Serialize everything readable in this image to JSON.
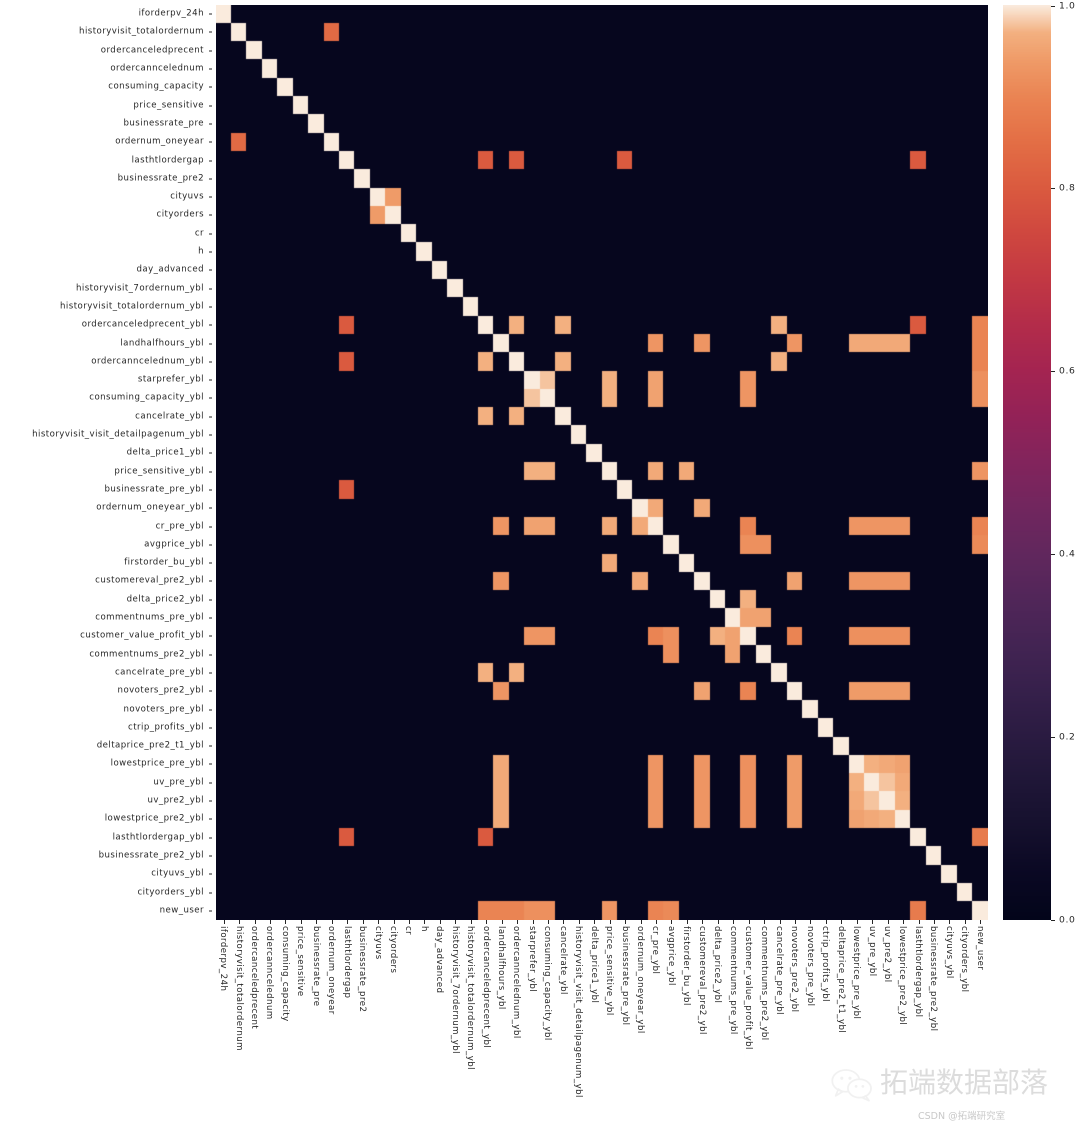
{
  "figure": {
    "type": "correlation-heatmap",
    "background": "#ffffff"
  },
  "colorbar": {
    "name": "rocket",
    "vmin": 0.0,
    "vmax": 1.0,
    "ticks": [
      "0.0",
      "0.2",
      "0.4",
      "0.6",
      "0.8",
      "1.0"
    ],
    "tick_values": [
      0.0,
      0.2,
      0.4,
      0.6,
      0.8,
      1.0
    ],
    "stops": [
      {
        "t": 0.0,
        "hex": "#03051A"
      },
      {
        "t": 0.05,
        "hex": "#0A0823"
      },
      {
        "t": 0.1,
        "hex": "#15102D"
      },
      {
        "t": 0.15,
        "hex": "#1F1637"
      },
      {
        "t": 0.2,
        "hex": "#2A1B41"
      },
      {
        "t": 0.25,
        "hex": "#36204B"
      },
      {
        "t": 0.3,
        "hex": "#432453"
      },
      {
        "t": 0.35,
        "hex": "#512659"
      },
      {
        "t": 0.4,
        "hex": "#61275D"
      },
      {
        "t": 0.45,
        "hex": "#71265E"
      },
      {
        "t": 0.5,
        "hex": "#82245C"
      },
      {
        "t": 0.55,
        "hex": "#932257"
      },
      {
        "t": 0.6,
        "hex": "#A42451"
      },
      {
        "t": 0.65,
        "hex": "#B32C4A"
      },
      {
        "t": 0.7,
        "hex": "#C23843"
      },
      {
        "t": 0.75,
        "hex": "#CF473F"
      },
      {
        "t": 0.8,
        "hex": "#DA5A3F"
      },
      {
        "t": 0.85,
        "hex": "#E36E45"
      },
      {
        "t": 0.9,
        "hex": "#EA8453"
      },
      {
        "t": 0.94,
        "hex": "#EF9B68"
      },
      {
        "t": 0.97,
        "hex": "#F3B08090"
      },
      {
        "t": 1.0,
        "hex": "#FAEBDD"
      }
    ]
  },
  "watermark": {
    "brand": "拓端数据部落",
    "source": "CSDN @拓端研究室",
    "logo": "wechat-icon"
  },
  "chart_data": {
    "type": "heatmap",
    "title": "",
    "xlabel": "",
    "ylabel": "",
    "colormap": "rocket",
    "zlim": [
      0.0,
      1.0
    ],
    "grid": false,
    "legend": "colorbar-right",
    "n": 48,
    "categories": [
      "iforderpv_24h",
      "historyvisit_totalordernum",
      "ordercanceledprecent",
      "ordercanncelednum",
      "consuming_capacity",
      "price_sensitive",
      "businessrate_pre",
      "ordernum_oneyear",
      "lasthtlordergap",
      "businessrate_pre2",
      "cityuvs",
      "cityorders",
      "cr",
      "h",
      "day_advanced",
      "historyvisit_7ordernum_ybl",
      "historyvisit_totalordernum_ybl",
      "ordercanceledprecent_ybl",
      "landhalfhours_ybl",
      "ordercanncelednum_ybl",
      "starprefer_ybl",
      "consuming_capacity_ybl",
      "cancelrate_ybl",
      "historyvisit_visit_detailpagenum_ybl",
      "delta_price1_ybl",
      "price_sensitive_ybl",
      "businessrate_pre_ybl",
      "ordernum_oneyear_ybl",
      "cr_pre_ybl",
      "avgprice_ybl",
      "firstorder_bu_ybl",
      "customereval_pre2_ybl",
      "delta_price2_ybl",
      "commentnums_pre_ybl",
      "customer_value_profit_ybl",
      "commentnums_pre2_ybl",
      "cancelrate_pre_ybl",
      "novoters_pre2_ybl",
      "novoters_pre_ybl",
      "ctrip_profits_ybl",
      "deltaprice_pre2_t1_ybl",
      "lowestprice_pre_ybl",
      "uv_pre_ybl",
      "uv_pre2_ybl",
      "lowestprice_pre2_ybl",
      "lasthtlordergap_ybl",
      "businessrate_pre2_ybl",
      "cityuvs_ybl",
      "cityorders_ybl",
      "new_user"
    ],
    "note_categories_count": 50,
    "row_labels": [
      "iforderpv_24h",
      "historyvisit_totalordernum",
      "ordercanceledprecent",
      "ordercanncelednum",
      "consuming_capacity",
      "price_sensitive",
      "businessrate_pre",
      "ordernum_oneyear",
      "lasthtlordergap",
      "businessrate_pre2",
      "cityuvs",
      "cityorders",
      "cr",
      "h",
      "day_advanced",
      "historyvisit_7ordernum_ybl",
      "historyvisit_totalordernum_ybl",
      "ordercanceledprecent_ybl",
      "landhalfhours_ybl",
      "ordercanncelednum_ybl",
      "starprefer_ybl",
      "consuming_capacity_ybl",
      "cancelrate_ybl",
      "historyvisit_visit_detailpagenum_ybl",
      "delta_price1_ybl",
      "price_sensitive_ybl",
      "businessrate_pre_ybl",
      "ordernum_oneyear_ybl",
      "cr_pre_ybl",
      "avgprice_ybl",
      "firstorder_bu_ybl",
      "customereval_pre2_ybl",
      "delta_price2_ybl",
      "commentnums_pre_ybl",
      "customer_value_profit_ybl",
      "commentnums_pre2_ybl",
      "cancelrate_pre_ybl",
      "novoters_pre2_ybl",
      "novoters_pre_ybl",
      "ctrip_profits_ybl",
      "deltaprice_pre2_t1_ybl",
      "lowestprice_pre_ybl",
      "uv_pre_ybl",
      "uv_pre2_ybl",
      "lowestprice_pre2_ybl",
      "lasthtlordergap_ybl",
      "businessrate_pre2_ybl",
      "cityuvs_ybl",
      "cityorders_ybl",
      "new_user"
    ],
    "col_labels": [
      "iforderpv_24h",
      "historyvisit_totalordernum",
      "ordercanceledprecent",
      "ordercanncelednum",
      "consuming_capacity",
      "price_sensitive",
      "businessrate_pre",
      "ordernum_oneyear",
      "lasthtlordergap",
      "businessrate_pre2",
      "cityuvs",
      "cityorders",
      "cr",
      "h",
      "day_advanced",
      "historyvisit_7ordernum_ybl",
      "historyvisit_totalordernum_ybl",
      "ordercanceledprecent_ybl",
      "landhalfhours_ybl",
      "ordercanncelednum_ybl",
      "starprefer_ybl",
      "consuming_capacity_ybl",
      "cancelrate_ybl",
      "historyvisit_visit_detailpagenum_ybl",
      "delta_price1_ybl",
      "price_sensitive_ybl",
      "businessrate_pre_ybl",
      "ordernum_oneyear_ybl",
      "cr_pre_ybl",
      "avgprice_ybl",
      "firstorder_bu_ybl",
      "customereval_pre2_ybl",
      "delta_price2_ybl",
      "commentnums_pre_ybl",
      "customer_value_profit_ybl",
      "commentnums_pre2_ybl",
      "cancelrate_pre_ybl",
      "novoters_pre2_ybl",
      "novoters_pre_ybl",
      "ctrip_profits_ybl",
      "deltaprice_pre2_t1_ybl",
      "lowestprice_pre_ybl",
      "uv_pre_ybl",
      "uv_pre2_ybl",
      "lowestprice_pre2_ybl",
      "lasthtlordergap_ybl",
      "businessrate_pre2_ybl",
      "cityuvs_ybl",
      "cityorders_ybl",
      "new_user"
    ],
    "background_value": 0.02,
    "diagonal_value": 1.0,
    "offdiagonal_cells": [
      {
        "r": 1,
        "c": 7,
        "v": 0.84
      },
      {
        "r": 7,
        "c": 1,
        "v": 0.84
      },
      {
        "r": 8,
        "c": 17,
        "v": 0.8
      },
      {
        "r": 17,
        "c": 8,
        "v": 0.8
      },
      {
        "r": 8,
        "c": 19,
        "v": 0.8
      },
      {
        "r": 19,
        "c": 8,
        "v": 0.8
      },
      {
        "r": 8,
        "c": 26,
        "v": 0.8
      },
      {
        "r": 26,
        "c": 8,
        "v": 0.8
      },
      {
        "r": 8,
        "c": 45,
        "v": 0.8
      },
      {
        "r": 45,
        "c": 8,
        "v": 0.8
      },
      {
        "r": 10,
        "c": 11,
        "v": 0.94
      },
      {
        "r": 11,
        "c": 10,
        "v": 0.94
      },
      {
        "r": 17,
        "c": 19,
        "v": 0.97
      },
      {
        "r": 19,
        "c": 17,
        "v": 0.97
      },
      {
        "r": 17,
        "c": 22,
        "v": 0.97
      },
      {
        "r": 22,
        "c": 17,
        "v": 0.97
      },
      {
        "r": 17,
        "c": 36,
        "v": 0.97
      },
      {
        "r": 36,
        "c": 17,
        "v": 0.97
      },
      {
        "r": 18,
        "c": 28,
        "v": 0.93
      },
      {
        "r": 28,
        "c": 18,
        "v": 0.93
      },
      {
        "r": 18,
        "c": 31,
        "v": 0.93
      },
      {
        "r": 31,
        "c": 18,
        "v": 0.93
      },
      {
        "r": 18,
        "c": 37,
        "v": 0.93
      },
      {
        "r": 37,
        "c": 18,
        "v": 0.93
      },
      {
        "r": 18,
        "c": 41,
        "v": 0.96
      },
      {
        "r": 41,
        "c": 18,
        "v": 0.96
      },
      {
        "r": 18,
        "c": 42,
        "v": 0.96
      },
      {
        "r": 42,
        "c": 18,
        "v": 0.96
      },
      {
        "r": 18,
        "c": 43,
        "v": 0.96
      },
      {
        "r": 43,
        "c": 18,
        "v": 0.96
      },
      {
        "r": 18,
        "c": 44,
        "v": 0.96
      },
      {
        "r": 44,
        "c": 18,
        "v": 0.96
      },
      {
        "r": 18,
        "c": 49,
        "v": 0.9
      },
      {
        "r": 49,
        "c": 18,
        "v": 0.9
      },
      {
        "r": 19,
        "c": 22,
        "v": 0.97
      },
      {
        "r": 22,
        "c": 19,
        "v": 0.97
      },
      {
        "r": 19,
        "c": 36,
        "v": 0.97
      },
      {
        "r": 36,
        "c": 19,
        "v": 0.97
      },
      {
        "r": 20,
        "c": 21,
        "v": 0.98
      },
      {
        "r": 21,
        "c": 20,
        "v": 0.98
      },
      {
        "r": 20,
        "c": 25,
        "v": 0.97
      },
      {
        "r": 25,
        "c": 20,
        "v": 0.97
      },
      {
        "r": 20,
        "c": 28,
        "v": 0.95
      },
      {
        "r": 28,
        "c": 20,
        "v": 0.95
      },
      {
        "r": 20,
        "c": 34,
        "v": 0.93
      },
      {
        "r": 34,
        "c": 20,
        "v": 0.93
      },
      {
        "r": 20,
        "c": 49,
        "v": 0.92
      },
      {
        "r": 49,
        "c": 20,
        "v": 0.92
      },
      {
        "r": 21,
        "c": 25,
        "v": 0.97
      },
      {
        "r": 25,
        "c": 21,
        "v": 0.97
      },
      {
        "r": 21,
        "c": 28,
        "v": 0.95
      },
      {
        "r": 28,
        "c": 21,
        "v": 0.95
      },
      {
        "r": 21,
        "c": 34,
        "v": 0.93
      },
      {
        "r": 34,
        "c": 21,
        "v": 0.93
      },
      {
        "r": 21,
        "c": 49,
        "v": 0.92
      },
      {
        "r": 49,
        "c": 21,
        "v": 0.92
      },
      {
        "r": 25,
        "c": 28,
        "v": 0.96
      },
      {
        "r": 28,
        "c": 25,
        "v": 0.96
      },
      {
        "r": 25,
        "c": 30,
        "v": 0.96
      },
      {
        "r": 30,
        "c": 25,
        "v": 0.96
      },
      {
        "r": 25,
        "c": 49,
        "v": 0.93
      },
      {
        "r": 49,
        "c": 25,
        "v": 0.93
      },
      {
        "r": 27,
        "c": 28,
        "v": 0.96
      },
      {
        "r": 28,
        "c": 27,
        "v": 0.96
      },
      {
        "r": 27,
        "c": 31,
        "v": 0.96
      },
      {
        "r": 31,
        "c": 27,
        "v": 0.96
      },
      {
        "r": 28,
        "c": 34,
        "v": 0.9
      },
      {
        "r": 34,
        "c": 28,
        "v": 0.9
      },
      {
        "r": 28,
        "c": 41,
        "v": 0.93
      },
      {
        "r": 41,
        "c": 28,
        "v": 0.93
      },
      {
        "r": 28,
        "c": 42,
        "v": 0.93
      },
      {
        "r": 42,
        "c": 28,
        "v": 0.93
      },
      {
        "r": 28,
        "c": 43,
        "v": 0.93
      },
      {
        "r": 43,
        "c": 28,
        "v": 0.93
      },
      {
        "r": 28,
        "c": 44,
        "v": 0.93
      },
      {
        "r": 44,
        "c": 28,
        "v": 0.93
      },
      {
        "r": 28,
        "c": 49,
        "v": 0.9
      },
      {
        "r": 49,
        "c": 28,
        "v": 0.9
      },
      {
        "r": 29,
        "c": 34,
        "v": 0.92
      },
      {
        "r": 34,
        "c": 29,
        "v": 0.92
      },
      {
        "r": 29,
        "c": 35,
        "v": 0.92
      },
      {
        "r": 35,
        "c": 29,
        "v": 0.92
      },
      {
        "r": 29,
        "c": 49,
        "v": 0.91
      },
      {
        "r": 49,
        "c": 29,
        "v": 0.91
      },
      {
        "r": 31,
        "c": 37,
        "v": 0.95
      },
      {
        "r": 37,
        "c": 31,
        "v": 0.95
      },
      {
        "r": 31,
        "c": 41,
        "v": 0.93
      },
      {
        "r": 41,
        "c": 31,
        "v": 0.93
      },
      {
        "r": 31,
        "c": 42,
        "v": 0.93
      },
      {
        "r": 42,
        "c": 31,
        "v": 0.93
      },
      {
        "r": 31,
        "c": 43,
        "v": 0.93
      },
      {
        "r": 43,
        "c": 31,
        "v": 0.93
      },
      {
        "r": 31,
        "c": 44,
        "v": 0.93
      },
      {
        "r": 44,
        "c": 31,
        "v": 0.93
      },
      {
        "r": 32,
        "c": 34,
        "v": 0.97
      },
      {
        "r": 34,
        "c": 32,
        "v": 0.97
      },
      {
        "r": 33,
        "c": 34,
        "v": 0.95
      },
      {
        "r": 34,
        "c": 33,
        "v": 0.95
      },
      {
        "r": 33,
        "c": 35,
        "v": 0.95
      },
      {
        "r": 35,
        "c": 33,
        "v": 0.95
      },
      {
        "r": 34,
        "c": 37,
        "v": 0.9
      },
      {
        "r": 37,
        "c": 34,
        "v": 0.9
      },
      {
        "r": 34,
        "c": 41,
        "v": 0.92
      },
      {
        "r": 41,
        "c": 34,
        "v": 0.92
      },
      {
        "r": 34,
        "c": 42,
        "v": 0.92
      },
      {
        "r": 42,
        "c": 34,
        "v": 0.92
      },
      {
        "r": 34,
        "c": 43,
        "v": 0.92
      },
      {
        "r": 43,
        "c": 34,
        "v": 0.92
      },
      {
        "r": 34,
        "c": 44,
        "v": 0.92
      },
      {
        "r": 44,
        "c": 34,
        "v": 0.92
      },
      {
        "r": 37,
        "c": 41,
        "v": 0.94
      },
      {
        "r": 41,
        "c": 37,
        "v": 0.94
      },
      {
        "r": 37,
        "c": 42,
        "v": 0.94
      },
      {
        "r": 42,
        "c": 37,
        "v": 0.94
      },
      {
        "r": 37,
        "c": 43,
        "v": 0.94
      },
      {
        "r": 43,
        "c": 37,
        "v": 0.94
      },
      {
        "r": 37,
        "c": 44,
        "v": 0.94
      },
      {
        "r": 44,
        "c": 37,
        "v": 0.94
      },
      {
        "r": 41,
        "c": 42,
        "v": 0.97
      },
      {
        "r": 42,
        "c": 41,
        "v": 0.97
      },
      {
        "r": 41,
        "c": 43,
        "v": 0.96
      },
      {
        "r": 43,
        "c": 41,
        "v": 0.96
      },
      {
        "r": 41,
        "c": 44,
        "v": 0.95
      },
      {
        "r": 44,
        "c": 41,
        "v": 0.95
      },
      {
        "r": 42,
        "c": 43,
        "v": 0.98
      },
      {
        "r": 43,
        "c": 42,
        "v": 0.98
      },
      {
        "r": 42,
        "c": 44,
        "v": 0.96
      },
      {
        "r": 44,
        "c": 42,
        "v": 0.96
      },
      {
        "r": 43,
        "c": 44,
        "v": 0.97
      },
      {
        "r": 44,
        "c": 43,
        "v": 0.97
      },
      {
        "r": 45,
        "c": 17,
        "v": 0.8
      },
      {
        "r": 17,
        "c": 45,
        "v": 0.8
      },
      {
        "r": 45,
        "c": 49,
        "v": 0.88
      },
      {
        "r": 49,
        "c": 45,
        "v": 0.88
      },
      {
        "r": 49,
        "c": 17,
        "v": 0.9
      },
      {
        "r": 17,
        "c": 49,
        "v": 0.9
      },
      {
        "r": 49,
        "c": 19,
        "v": 0.9
      },
      {
        "r": 19,
        "c": 49,
        "v": 0.9
      }
    ]
  }
}
